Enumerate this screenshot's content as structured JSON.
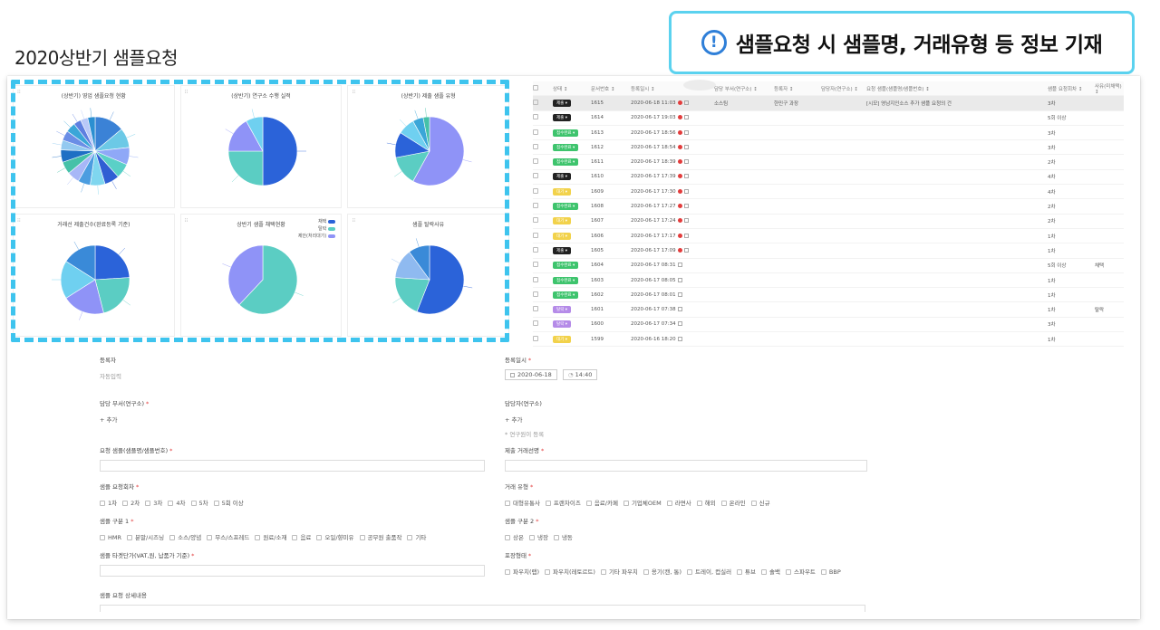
{
  "page": {
    "title": "2020상반기 샘플요청"
  },
  "callout": {
    "icon": "info-icon",
    "text": "샘플요청 시 샘플명, 거래유형 등 정보 기재"
  },
  "charts": [
    {
      "title": "(상반기) 영업 샘플요청 현황",
      "colors": [
        "#3b82d6",
        "#6cc9e6",
        "#8fa8f7",
        "#5ad0c7",
        "#2f5fd3",
        "#7fd6ef",
        "#4b9de0",
        "#a7b7f7",
        "#45c1a8",
        "#1f6fc4",
        "#93c9f0",
        "#6a8ee6",
        "#3aa6d8",
        "#5e7fe0",
        "#b8c8f8",
        "#2b8fd1"
      ]
    },
    {
      "title": "(상반기) 연구소 수행 실적",
      "colors": [
        "#2b63d9",
        "#5bcdc3",
        "#8f93f7",
        "#6fd0f0"
      ]
    },
    {
      "title": "(상반기) 제출 샘플 유형",
      "colors": [
        "#8f93f7",
        "#5bcdc3",
        "#2b63d9",
        "#6fd0f0",
        "#3aa6d8",
        "#45c1a8"
      ]
    },
    {
      "title": "거래선 제출건수(완료등록 기준)",
      "colors": [
        "#2b63d9",
        "#5bcdc3",
        "#8f93f7",
        "#6fd0f0",
        "#3a8ad8"
      ]
    },
    {
      "title": "상반기 샘플 채택현황",
      "colors": [
        "#5bcdc3",
        "#8f93f7"
      ],
      "legend": [
        "채택",
        "탈락",
        "제안(처리대기)"
      ],
      "legend_colors": [
        "#2b63d9",
        "#5bcdc3",
        "#8f93f7"
      ]
    },
    {
      "title": "샘플 탈락사유",
      "colors": [
        "#2b63d9",
        "#5bcdc3",
        "#8fbaf0",
        "#3a8ad8"
      ]
    }
  ],
  "chart_data": [
    {
      "type": "pie",
      "title": "(상반기) 영업 샘플요청 현황",
      "values": [
        12,
        8,
        7,
        6,
        6,
        6,
        5,
        5,
        5,
        5,
        4,
        4,
        4,
        3,
        3,
        3
      ]
    },
    {
      "type": "pie",
      "title": "(상반기) 연구소 수행 실적",
      "values": [
        50,
        25,
        17,
        8
      ]
    },
    {
      "type": "pie",
      "title": "(상반기) 제출 샘플 유형",
      "values": [
        58,
        14,
        12,
        8,
        5,
        3
      ]
    },
    {
      "type": "pie",
      "title": "거래선 제출건수(완료등록 기준)",
      "values": [
        24,
        22,
        20,
        18,
        16
      ]
    },
    {
      "type": "pie",
      "title": "상반기 샘플 채택현황",
      "values": [
        62,
        38
      ]
    },
    {
      "type": "pie",
      "title": "샘플 탈락사유",
      "values": [
        56,
        20,
        14,
        10
      ]
    }
  ],
  "table": {
    "headers": [
      "상태",
      "문서번호",
      "등록일시",
      "담당 부서(연구소)",
      "등록자",
      "담당자(연구소)",
      "요청 샘플(샘플명/샘플번호)",
      "샘플 요청회차",
      "사유(미채택)"
    ],
    "rows": [
      {
        "status": "제출",
        "color": "#222",
        "no": "1615",
        "date": "2020-06-18 11:03",
        "dot": true,
        "dept": "소스팀",
        "reg": "한민구 과장",
        "sample": "[시모] 영남지인소스 추가 샘플 요청의 건",
        "round": "3차",
        "reason": ""
      },
      {
        "status": "제출",
        "color": "#222",
        "no": "1614",
        "date": "2020-06-17 19:03",
        "dot": true,
        "dept": "",
        "reg": "",
        "sample": "",
        "round": "5회 이상",
        "reason": ""
      },
      {
        "status": "접수완료",
        "color": "#3ec46d",
        "no": "1613",
        "date": "2020-06-17 18:56",
        "dot": true,
        "dept": "",
        "reg": "",
        "sample": "",
        "round": "3차",
        "reason": ""
      },
      {
        "status": "접수완료",
        "color": "#3ec46d",
        "no": "1612",
        "date": "2020-06-17 18:54",
        "dot": true,
        "dept": "",
        "reg": "",
        "sample": "",
        "round": "3차",
        "reason": ""
      },
      {
        "status": "접수완료",
        "color": "#3ec46d",
        "no": "1611",
        "date": "2020-06-17 18:39",
        "dot": true,
        "dept": "",
        "reg": "",
        "sample": "",
        "round": "2차",
        "reason": ""
      },
      {
        "status": "제출",
        "color": "#222",
        "no": "1610",
        "date": "2020-06-17 17:39",
        "dot": true,
        "dept": "",
        "reg": "",
        "sample": "",
        "round": "4차",
        "reason": ""
      },
      {
        "status": "대기",
        "color": "#f2d24b",
        "no": "1609",
        "date": "2020-06-17 17:30",
        "dot": true,
        "dept": "",
        "reg": "",
        "sample": "",
        "round": "4차",
        "reason": ""
      },
      {
        "status": "접수완료",
        "color": "#3ec46d",
        "no": "1608",
        "date": "2020-06-17 17:27",
        "dot": true,
        "dept": "",
        "reg": "",
        "sample": "",
        "round": "2차",
        "reason": ""
      },
      {
        "status": "대기",
        "color": "#f2d24b",
        "no": "1607",
        "date": "2020-06-17 17:24",
        "dot": true,
        "dept": "",
        "reg": "",
        "sample": "",
        "round": "2차",
        "reason": ""
      },
      {
        "status": "대기",
        "color": "#f2d24b",
        "no": "1606",
        "date": "2020-06-17 17:17",
        "dot": true,
        "dept": "",
        "reg": "",
        "sample": "",
        "round": "1차",
        "reason": ""
      },
      {
        "status": "제출",
        "color": "#222",
        "no": "1605",
        "date": "2020-06-17 17:09",
        "dot": true,
        "dept": "",
        "reg": "",
        "sample": "",
        "round": "1차",
        "reason": ""
      },
      {
        "status": "접수완료",
        "color": "#3ec46d",
        "no": "1604",
        "date": "2020-06-17 08:31",
        "dot": false,
        "dept": "",
        "reg": "",
        "sample": "",
        "round": "5회 이상",
        "reason": "채택"
      },
      {
        "status": "접수완료",
        "color": "#3ec46d",
        "no": "1603",
        "date": "2020-06-17 08:05",
        "dot": false,
        "dept": "",
        "reg": "",
        "sample": "",
        "round": "1차",
        "reason": ""
      },
      {
        "status": "접수완료",
        "color": "#3ec46d",
        "no": "1602",
        "date": "2020-06-17 08:01",
        "dot": false,
        "dept": "",
        "reg": "",
        "sample": "",
        "round": "1차",
        "reason": ""
      },
      {
        "status": "탈락",
        "color": "#b58be8",
        "no": "1601",
        "date": "2020-06-17 07:38",
        "dot": false,
        "dept": "",
        "reg": "",
        "sample": "",
        "round": "1차",
        "reason": "탈락"
      },
      {
        "status": "탈락",
        "color": "#b58be8",
        "no": "1600",
        "date": "2020-06-17 07:34",
        "dot": false,
        "dept": "",
        "reg": "",
        "sample": "",
        "round": "3차",
        "reason": ""
      },
      {
        "status": "대기",
        "color": "#f2d24b",
        "no": "1599",
        "date": "2020-06-16 18:20",
        "dot": false,
        "dept": "",
        "reg": "",
        "sample": "",
        "round": "1차",
        "reason": ""
      }
    ]
  },
  "form": {
    "registrant_label": "등록자",
    "registrant_value": "자동입력",
    "reg_date_label": "등록일시",
    "reg_date": "2020-06-18",
    "reg_time": "14:40",
    "dept_label": "담당 부서(연구소)",
    "dept_add": "+ 추가",
    "manager_label": "담당자(연구소)",
    "manager_add": "+ 추가",
    "manager_hint": "* 연구원이 등록",
    "sample_label": "요청 샘플(샘플명/샘플번호)",
    "partner_label": "제출 거래선명",
    "round_label": "샘플 요청회차",
    "round_opts": [
      "1차",
      "2차",
      "3차",
      "4차",
      "5차",
      "5회 이상"
    ],
    "trade_label": "거래 유형",
    "trade_opts": [
      "대형유통사",
      "프랜차이즈",
      "음료/카페",
      "기업체OEM",
      "라면사",
      "해외",
      "온라인",
      "신규"
    ],
    "cat1_label": "샘플 구분 1",
    "cat1_opts": [
      "HMR",
      "분말/시즈닝",
      "소스/양념",
      "무스/스프레드",
      "원료/소재",
      "음료",
      "오일/향미유",
      "공무원 출품작",
      "기타"
    ],
    "cat2_label": "샘플 구분 2",
    "cat2_opts": [
      "상온",
      "냉장",
      "냉동"
    ],
    "price_label": "샘플 타겟단가(VAT,원, 납품가 기준)",
    "pack_label": "포장형태",
    "pack_opts": [
      "파우치(랩)",
      "파우치(레토르트)",
      "기타 파우치",
      "용기(캔, 통)",
      "트레이, 컵실러",
      "튜브",
      "솔백",
      "스파우트",
      "BBP"
    ],
    "detail_label": "샘플 요청 상세내용"
  }
}
